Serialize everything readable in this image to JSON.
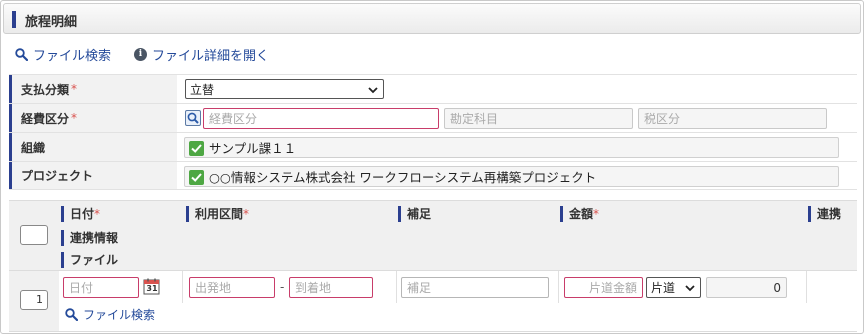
{
  "header": {
    "title": "旅程明細"
  },
  "actions": {
    "file_search": "ファイル検索",
    "file_detail": "ファイル詳細を開く"
  },
  "form": {
    "payment": {
      "label": "支払分類",
      "required_mark": "*",
      "value": "立替"
    },
    "expense": {
      "label": "経費区分",
      "required_mark": "*",
      "expense_placeholder": "経費区分",
      "account_placeholder": "勘定科目",
      "tax_placeholder": "税区分"
    },
    "organization": {
      "label": "組織",
      "value": "サンプル課１１"
    },
    "project": {
      "label": "プロジェクト",
      "value": "○○情報システム株式会社 ワークフローシステム再構築プロジェクト"
    }
  },
  "grid": {
    "columns": {
      "date": "日付",
      "route": "利用区間",
      "supplement": "補足",
      "amount": "金額",
      "linkage": "連携",
      "required_mark": "*"
    },
    "sub_headers": {
      "linkage_info": "連携情報",
      "file": "ファイル"
    },
    "row": {
      "number": "1",
      "date_placeholder": "日付",
      "calendar_day": "31",
      "departure_placeholder": "出発地",
      "separator": "-",
      "arrival_placeholder": "到着地",
      "supplement_placeholder": "補足",
      "fare_placeholder": "片道金額",
      "trip_type": "片道",
      "total": "0",
      "file_search": "ファイル検索"
    }
  },
  "colors": {
    "accent": "#2b3f8f",
    "link": "#244a9a",
    "required": "#d9534f",
    "check": "#4ea743",
    "invalid_border": "#c83d6a"
  }
}
